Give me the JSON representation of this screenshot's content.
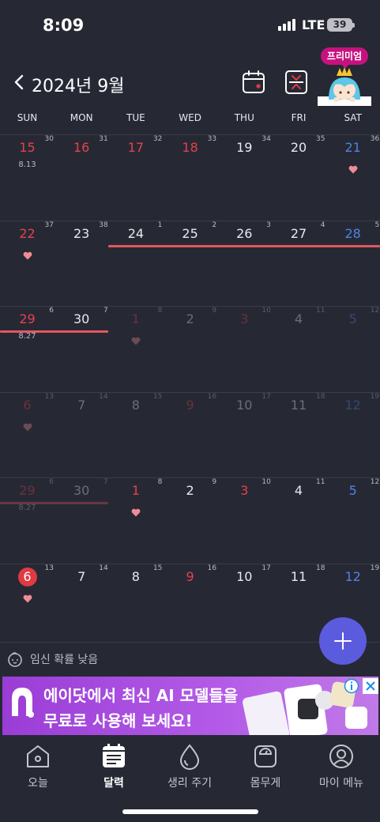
{
  "status_bar": {
    "time": "8:09",
    "network": "LTE",
    "battery": "39"
  },
  "header": {
    "month_title": "2024년 9월",
    "premium_badge": "프리미엄"
  },
  "weekdays": [
    "SUN",
    "MON",
    "TUE",
    "WED",
    "THU",
    "FRI",
    "SAT"
  ],
  "calendar": {
    "weeks": [
      {
        "days": [
          {
            "day": "15",
            "week_no": "30",
            "note": "8.13",
            "color": "red",
            "dim": false,
            "heart": false,
            "today": false
          },
          {
            "day": "16",
            "week_no": "31",
            "note": "",
            "color": "red",
            "dim": false,
            "heart": false,
            "today": false
          },
          {
            "day": "17",
            "week_no": "32",
            "note": "",
            "color": "red",
            "dim": false,
            "heart": false,
            "today": false
          },
          {
            "day": "18",
            "week_no": "33",
            "note": "",
            "color": "red",
            "dim": false,
            "heart": false,
            "today": false
          },
          {
            "day": "19",
            "week_no": "34",
            "note": "",
            "color": "normal",
            "dim": false,
            "heart": false,
            "today": false
          },
          {
            "day": "20",
            "week_no": "35",
            "note": "",
            "color": "normal",
            "dim": false,
            "heart": false,
            "today": false
          },
          {
            "day": "21",
            "week_no": "36",
            "note": "",
            "color": "blue",
            "dim": false,
            "heart": true,
            "today": false
          }
        ],
        "bar": null
      },
      {
        "days": [
          {
            "day": "22",
            "week_no": "37",
            "note": "",
            "color": "red",
            "dim": false,
            "heart": true,
            "today": false
          },
          {
            "day": "23",
            "week_no": "38",
            "note": "",
            "color": "normal",
            "dim": false,
            "heart": false,
            "today": false
          },
          {
            "day": "24",
            "week_no": "1",
            "note": "",
            "color": "normal",
            "dim": false,
            "heart": false,
            "today": false
          },
          {
            "day": "25",
            "week_no": "2",
            "note": "",
            "color": "normal",
            "dim": false,
            "heart": false,
            "today": false
          },
          {
            "day": "26",
            "week_no": "3",
            "note": "",
            "color": "normal",
            "dim": false,
            "heart": false,
            "today": false
          },
          {
            "day": "27",
            "week_no": "4",
            "note": "",
            "color": "normal",
            "dim": false,
            "heart": false,
            "today": false
          },
          {
            "day": "28",
            "week_no": "5",
            "note": "",
            "color": "blue",
            "dim": false,
            "heart": false,
            "today": false
          }
        ],
        "bar": {
          "from_col": 2,
          "to_col": 6,
          "faded": false
        }
      },
      {
        "days": [
          {
            "day": "29",
            "week_no": "6",
            "note": "8.27",
            "color": "red",
            "dim": false,
            "heart": false,
            "today": false
          },
          {
            "day": "30",
            "week_no": "7",
            "note": "",
            "color": "normal",
            "dim": false,
            "heart": false,
            "today": false
          },
          {
            "day": "1",
            "week_no": "8",
            "note": "",
            "color": "red",
            "dim": true,
            "heart": true,
            "today": false
          },
          {
            "day": "2",
            "week_no": "9",
            "note": "",
            "color": "normal",
            "dim": true,
            "heart": false,
            "today": false
          },
          {
            "day": "3",
            "week_no": "10",
            "note": "",
            "color": "red",
            "dim": true,
            "heart": false,
            "today": false
          },
          {
            "day": "4",
            "week_no": "11",
            "note": "",
            "color": "normal",
            "dim": true,
            "heart": false,
            "today": false
          },
          {
            "day": "5",
            "week_no": "12",
            "note": "",
            "color": "blue",
            "dim": true,
            "heart": false,
            "today": false
          }
        ],
        "bar": {
          "from_col": 0,
          "to_col": 1,
          "faded": false
        }
      },
      {
        "days": [
          {
            "day": "6",
            "week_no": "13",
            "note": "",
            "color": "red",
            "dim": true,
            "heart": true,
            "today": false
          },
          {
            "day": "7",
            "week_no": "14",
            "note": "",
            "color": "normal",
            "dim": true,
            "heart": false,
            "today": false
          },
          {
            "day": "8",
            "week_no": "15",
            "note": "",
            "color": "normal",
            "dim": true,
            "heart": false,
            "today": false
          },
          {
            "day": "9",
            "week_no": "16",
            "note": "",
            "color": "red",
            "dim": true,
            "heart": false,
            "today": false
          },
          {
            "day": "10",
            "week_no": "17",
            "note": "",
            "color": "normal",
            "dim": true,
            "heart": false,
            "today": false
          },
          {
            "day": "11",
            "week_no": "18",
            "note": "",
            "color": "normal",
            "dim": true,
            "heart": false,
            "today": false
          },
          {
            "day": "12",
            "week_no": "19",
            "note": "",
            "color": "blue",
            "dim": true,
            "heart": false,
            "today": false
          }
        ],
        "bar": null
      },
      {
        "days": [
          {
            "day": "29",
            "week_no": "6",
            "note": "8.27",
            "color": "red",
            "dim": true,
            "heart": false,
            "today": false
          },
          {
            "day": "30",
            "week_no": "7",
            "note": "",
            "color": "normal",
            "dim": true,
            "heart": false,
            "today": false
          },
          {
            "day": "1",
            "week_no": "8",
            "note": "",
            "color": "red",
            "dim": false,
            "heart": true,
            "today": false
          },
          {
            "day": "2",
            "week_no": "9",
            "note": "",
            "color": "normal",
            "dim": false,
            "heart": false,
            "today": false
          },
          {
            "day": "3",
            "week_no": "10",
            "note": "",
            "color": "red",
            "dim": false,
            "heart": false,
            "today": false
          },
          {
            "day": "4",
            "week_no": "11",
            "note": "",
            "color": "normal",
            "dim": false,
            "heart": false,
            "today": false
          },
          {
            "day": "5",
            "week_no": "12",
            "note": "",
            "color": "blue",
            "dim": false,
            "heart": false,
            "today": false
          }
        ],
        "bar": {
          "from_col": 0,
          "to_col": 1,
          "faded": false
        }
      },
      {
        "days": [
          {
            "day": "6",
            "week_no": "13",
            "note": "",
            "color": "red",
            "dim": false,
            "heart": true,
            "today": true
          },
          {
            "day": "7",
            "week_no": "14",
            "note": "",
            "color": "normal",
            "dim": false,
            "heart": false,
            "today": false
          },
          {
            "day": "8",
            "week_no": "15",
            "note": "",
            "color": "normal",
            "dim": false,
            "heart": false,
            "today": false
          },
          {
            "day": "9",
            "week_no": "16",
            "note": "",
            "color": "red",
            "dim": false,
            "heart": false,
            "today": false
          },
          {
            "day": "10",
            "week_no": "17",
            "note": "",
            "color": "normal",
            "dim": false,
            "heart": false,
            "today": false
          },
          {
            "day": "11",
            "week_no": "18",
            "note": "",
            "color": "normal",
            "dim": false,
            "heart": false,
            "today": false
          },
          {
            "day": "12",
            "week_no": "19",
            "note": "",
            "color": "blue",
            "dim": false,
            "heart": false,
            "today": false
          }
        ],
        "bar": null
      }
    ]
  },
  "fertility": {
    "text": "임신 확률 낮음"
  },
  "ad": {
    "line1": "에이닷에서 최신 AI 모델들을",
    "line2": "무료로 사용해 보세요!"
  },
  "nav": {
    "items": [
      {
        "label": "오늘",
        "icon": "home-icon",
        "active": false
      },
      {
        "label": "달력",
        "icon": "calendar-icon",
        "active": true
      },
      {
        "label": "생리 주기",
        "icon": "drop-icon",
        "active": false
      },
      {
        "label": "몸무게",
        "icon": "scale-icon",
        "active": false
      },
      {
        "label": "마이 메뉴",
        "icon": "profile-icon",
        "active": false
      }
    ]
  },
  "colors": {
    "background": "#262934",
    "accent": "#5b5bde",
    "period_bar": "#e2575f",
    "sunday": "#e5414a",
    "saturday": "#4f82e8",
    "premium": "#c6127e"
  }
}
